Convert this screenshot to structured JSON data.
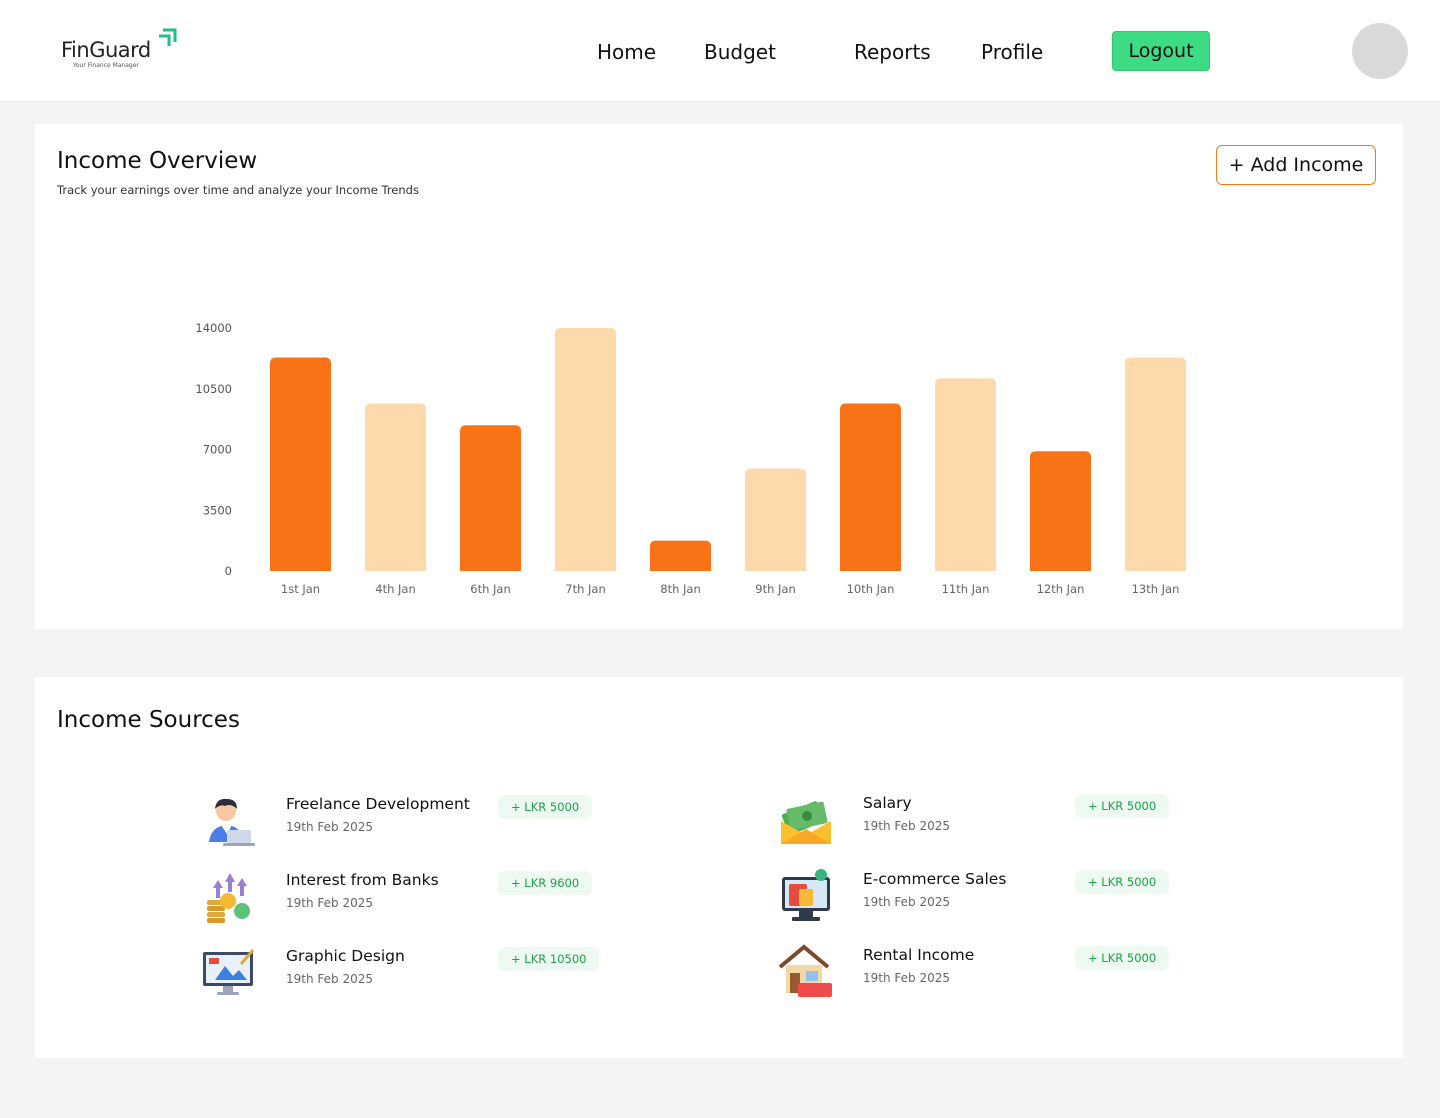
{
  "brand": {
    "name": "FinGuard",
    "tagline": "Your Finance Manager",
    "accent": "#1bbf8a"
  },
  "nav": {
    "links": [
      {
        "label": "Home"
      },
      {
        "label": "Budget"
      },
      {
        "label": "Reports"
      },
      {
        "label": "Profile"
      }
    ],
    "logout_label": "Logout",
    "logout_color": "#3ddc84"
  },
  "overview": {
    "title": "Income Overview",
    "subtitle": "Track your earnings over time and analyze your Income Trends",
    "add_button": "+ Add Income"
  },
  "chart_data": {
    "type": "bar",
    "categories": [
      "1st Jan",
      "4th Jan",
      "6th Jan",
      "7th Jan",
      "8th Jan",
      "9th Jan",
      "10th Jan",
      "11th Jan",
      "12th Jan",
      "13th Jan"
    ],
    "values": [
      12300,
      9650,
      8400,
      14000,
      1750,
      5900,
      9650,
      11100,
      6900,
      12300
    ],
    "yticks": [
      0,
      3500,
      7000,
      10500,
      14000
    ],
    "ylim": [
      0,
      14000
    ],
    "grid": false,
    "colors": [
      "#f97316",
      "#fdd9ac"
    ]
  },
  "sources": {
    "title": "Income Sources",
    "items": [
      {
        "name": "Freelance Development",
        "date": "19th Feb 2025",
        "amount": "+ LKR 5000",
        "icon": "freelancer-icon"
      },
      {
        "name": "Salary",
        "date": "19th Feb 2025",
        "amount": "+ LKR 5000",
        "icon": "salary-envelope-icon"
      },
      {
        "name": "Interest from Banks",
        "date": "19th Feb 2025",
        "amount": "+ LKR 9600",
        "icon": "interest-coins-icon"
      },
      {
        "name": "E-commerce Sales",
        "date": "19th Feb 2025",
        "amount": "+ LKR 5000",
        "icon": "ecommerce-icon"
      },
      {
        "name": "Graphic Design",
        "date": "19th Feb 2025",
        "amount": "+ LKR 10500",
        "icon": "graphic-design-icon"
      },
      {
        "name": "Rental Income",
        "date": "19th Feb 2025",
        "amount": "+ LKR 5000",
        "icon": "rent-house-icon"
      }
    ]
  }
}
